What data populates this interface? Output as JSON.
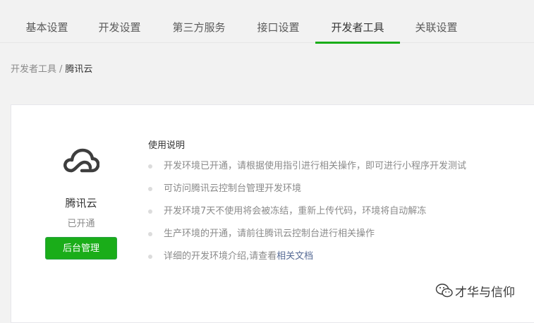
{
  "tabs": [
    {
      "label": "基本设置"
    },
    {
      "label": "开发设置"
    },
    {
      "label": "第三方服务"
    },
    {
      "label": "接口设置"
    },
    {
      "label": "开发者工具"
    },
    {
      "label": "关联设置"
    }
  ],
  "active_tab": "开发者工具",
  "accent_color": "#1aad19",
  "breadcrumb": {
    "parent": "开发者工具",
    "separator": "/",
    "current": "腾讯云"
  },
  "service": {
    "icon": "cloud-icon",
    "name": "腾讯云",
    "status": "已开通",
    "button_label": "后台管理"
  },
  "usage": {
    "title": "使用说明",
    "items": [
      {
        "text": "开发环境已开通，请根据使用指引进行相关操作，即可进行小程序开发测试"
      },
      {
        "text": "可访问腾讯云控制台管理开发环境"
      },
      {
        "text": "开发环境7天不使用将会被冻结，重新上传代码，环境将自动解冻"
      },
      {
        "text": "生产环境的开通，请前往腾讯云控制台进行相关操作"
      },
      {
        "text": "详细的开发环境介绍,请查看",
        "link": "相关文档"
      }
    ]
  },
  "watermark": {
    "icon": "wechat-icon",
    "text": "才华与信仰"
  }
}
